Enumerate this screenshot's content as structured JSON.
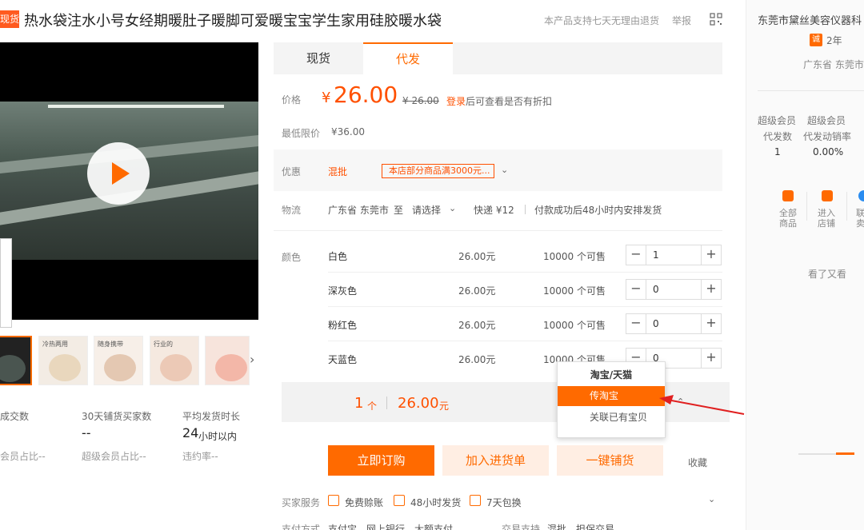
{
  "header": {
    "badge": "现货帮",
    "title": "热水袋注水小号女经期暖肚子暖脚可爱暖宝宝学生家用硅胶暖水袋",
    "support_text": "本产品支持七天无理由退货",
    "report_label": "举报"
  },
  "thumbnails": [
    {
      "caption": ""
    },
    {
      "caption": "冷热两用"
    },
    {
      "caption": "随身携带"
    },
    {
      "caption": "行业的"
    },
    {
      "caption": ""
    }
  ],
  "stats": {
    "col1": {
      "label": "成交数",
      "sub": "会员占比--"
    },
    "col2": {
      "label": "30天铺货买家数",
      "value": "--",
      "sub": "超级会员占比--"
    },
    "col3": {
      "label": "平均发货时长",
      "value": "24",
      "value_unit": "小时以内",
      "sub": "违约率--"
    }
  },
  "tabs": {
    "inactive": "现货",
    "active": "代发"
  },
  "price": {
    "label": "价格",
    "symbol": "¥",
    "value": "26.00",
    "old_value": "¥ 26.00",
    "login_link": "登录",
    "login_rest": "后可查看是否有折扣",
    "min_label": "最低限价",
    "min_value": "¥36.00"
  },
  "promo": {
    "label": "优惠",
    "mixed": "混批",
    "coupon": "本店部分商品满3000元..."
  },
  "logistics": {
    "label": "物流",
    "from": "广东省 东莞市",
    "to_word": "至",
    "select": "请选择",
    "express": "快递 ¥12",
    "ship_note": "付款成功后48小时内安排发货"
  },
  "colors": {
    "label": "颜色",
    "items": [
      {
        "name": "白色",
        "price": "26.00元",
        "stock": "10000 个可售",
        "qty": "1"
      },
      {
        "name": "深灰色",
        "price": "26.00元",
        "stock": "10000 个可售",
        "qty": "0"
      },
      {
        "name": "粉红色",
        "price": "26.00元",
        "stock": "10000 个可售",
        "qty": "0"
      },
      {
        "name": "天蓝色",
        "price": "26.00元",
        "stock": "10000 个可售",
        "qty": "0"
      }
    ],
    "minus": "−",
    "plus": "+"
  },
  "summary": {
    "count": "1",
    "count_unit": "个",
    "price": "26.00",
    "price_unit": "元"
  },
  "dropdown": {
    "header": "淘宝/天猫",
    "active_item": "传淘宝",
    "item": "关联已有宝贝"
  },
  "actions": {
    "order": "立即订购",
    "add_cart": "加入进货单",
    "distribute": "一键铺货",
    "favorite": "收藏"
  },
  "services": {
    "label": "买家服务",
    "items": [
      "免费赊账",
      "48小时发货",
      "7天包换"
    ],
    "pay_label": "支付方式",
    "pay_items": "支付宝　网上银行　大额支付",
    "trade_label": "交易支持",
    "trade_items": "混批　担保交易"
  },
  "seller": {
    "name": "东莞市黛丝美容仪器科",
    "badge": "诚",
    "years": "2年",
    "location": "广东省 东莞市",
    "stat1_label": "超级会员",
    "stat1_label2": "代发数",
    "stat1_value": "1",
    "stat2_label": "超级会员",
    "stat2_label2": "代发动销率",
    "stat2_value": "0.00%",
    "links": [
      {
        "line1": "全部",
        "line2": "商品"
      },
      {
        "line1": "进入",
        "line2": "店铺"
      },
      {
        "line1": "联",
        "line2": "卖"
      }
    ],
    "more": "看了又看"
  },
  "accent_color": "#ff6a00",
  "price_color": "#ff5000"
}
